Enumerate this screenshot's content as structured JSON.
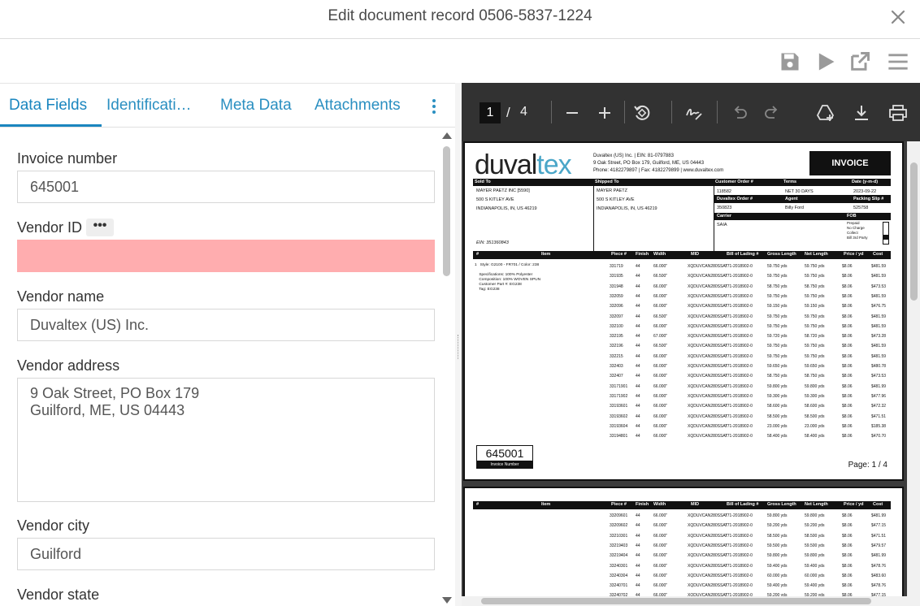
{
  "window": {
    "title": "Edit document record 0506-5837-1224"
  },
  "tabs": [
    {
      "label": "Data Fields"
    },
    {
      "label": "Identificati…"
    },
    {
      "label": "Meta Data"
    },
    {
      "label": "Attachments"
    }
  ],
  "fields": {
    "invoice_number": {
      "label": "Invoice number",
      "value": "645001"
    },
    "vendor_id": {
      "label": "Vendor ID",
      "value": "",
      "more": "•••"
    },
    "vendor_name": {
      "label": "Vendor name",
      "value": "Duvaltex (US) Inc."
    },
    "vendor_address": {
      "label": "Vendor address",
      "value": "9 Oak Street, PO Box 179\nGuilford, ME, US 04443"
    },
    "vendor_city": {
      "label": "Vendor city",
      "value": "Guilford"
    },
    "vendor_state": {
      "label": "Vendor state"
    }
  },
  "viewer": {
    "page": "1",
    "separator": "/",
    "total_pages": "4"
  },
  "invoice": {
    "logo_a": "duval",
    "logo_b": "tex",
    "vendor_line1": "Duvaltex (US) Inc. | EIN: 81-0797883",
    "vendor_line2": "9 Oak Street, PO Box 179, Guilford, ME, US 04443",
    "vendor_line3": "Phone: 4182279897 | Fax: 4182279899 | www.duvaltex.com",
    "title": "INVOICE",
    "sold_to_hdr": "Sold To",
    "shipped_to_hdr": "Shipped To",
    "cust_order_hdr": "Customer Order #",
    "terms_hdr": "Terms",
    "date_hdr": "Date (y-m-d)",
    "sold_to": "MAYER PAETZ INC [5590]\n500 S KITLEY AVE\nINDIANAPOLIS, IN, US 46219",
    "shipped_to": "MAYER PAETZ\n500 S KITLEY AVE\nINDIANAPOLIS, IN, US 46219",
    "cust_order": "118582",
    "terms": "NET 30 DAYS",
    "date": "2023-09-22",
    "duv_order_hdr": "Duvaltex Order #",
    "agent_hdr": "Agent",
    "packing_hdr": "Packing Slip #",
    "duv_order": "350823",
    "agent": "Billy Ford",
    "packing": "525758",
    "carrier_hdr": "Carrier",
    "fob_hdr": "FOB",
    "carrier": "SAIA",
    "fob_opts": "Prepaid\nNo Charge\nCollect\nBill 3rd Party",
    "ein": "EIN: 351360843",
    "col_headers": [
      "#",
      "Item",
      "Piece #",
      "Finish",
      "Width",
      "MID",
      "Bill of Lading #",
      "Gross Length",
      "Net Length",
      "Price / yd",
      "Cost"
    ],
    "item_desc": "1   Style: G2100 - FR701 / Color: 238\n\n    Specifications: 100% Polyester\n    Composition: 100% WOVEN SPUN\n    Customer Part #: EG238\n    Tag: EG238",
    "rows": [
      [
        "331719",
        "44",
        "66.000\"",
        "XQDUVCAN280SSAI",
        "771-2018902-0",
        "59.750 yds",
        "59.750 yds",
        "$8.06",
        "$481.59"
      ],
      [
        "331935",
        "44",
        "66.500\"",
        "XQDUVCAN280SSAI",
        "771-2018902-0",
        "59.750 yds",
        "59.750 yds",
        "$8.06",
        "$481.59"
      ],
      [
        "331948",
        "44",
        "66.000\"",
        "XQDUVCAN280SSAI",
        "771-2018902-0",
        "58.750 yds",
        "58.750 yds",
        "$8.06",
        "$473.53"
      ],
      [
        "332059",
        "44",
        "66.000\"",
        "XQDUVCAN280SSAI",
        "771-2018902-0",
        "59.750 yds",
        "59.750 yds",
        "$8.06",
        "$481.59"
      ],
      [
        "332096",
        "44",
        "66.000\"",
        "XQDUVCAN280SSAI",
        "771-2018902-0",
        "59.150 yds",
        "59.150 yds",
        "$8.06",
        "$476.75"
      ],
      [
        "332097",
        "44",
        "66.500\"",
        "XQDUVCAN280SSAI",
        "771-2018902-0",
        "59.750 yds",
        "59.750 yds",
        "$8.06",
        "$481.59"
      ],
      [
        "332100",
        "44",
        "66.000\"",
        "XQDUVCAN280SSAI",
        "771-2018902-0",
        "59.750 yds",
        "59.750 yds",
        "$8.06",
        "$481.59"
      ],
      [
        "332195",
        "44",
        "67.000\"",
        "XQDUVCAN280SSAI",
        "771-2018902-0",
        "59.720 yds",
        "58.720 yds",
        "$8.06",
        "$473.28"
      ],
      [
        "332196",
        "44",
        "66.500\"",
        "XQDUVCAN280SSAI",
        "771-2018902-0",
        "59.750 yds",
        "59.750 yds",
        "$8.06",
        "$481.59"
      ],
      [
        "332215",
        "44",
        "66.000\"",
        "XQDUVCAN280SSAI",
        "771-2018902-0",
        "59.750 yds",
        "59.750 yds",
        "$8.06",
        "$481.59"
      ],
      [
        "332403",
        "44",
        "66.000\"",
        "XQDUVCAN280SSAI",
        "771-2018902-0",
        "59.650 yds",
        "59.650 yds",
        "$8.06",
        "$480.78"
      ],
      [
        "332407",
        "44",
        "66.000\"",
        "XQDUVCAN280SSAI",
        "771-2018902-0",
        "58.750 yds",
        "58.750 yds",
        "$8.06",
        "$473.53"
      ],
      [
        "33171901",
        "44",
        "66.000\"",
        "XQDUVCAN280SSAI",
        "771-2018902-0",
        "59.800 yds",
        "59.800 yds",
        "$8.06",
        "$481.99"
      ],
      [
        "33171902",
        "44",
        "66.000\"",
        "XQDUVCAN280SSAI",
        "771-2018902-0",
        "59.300 yds",
        "59.300 yds",
        "$8.06",
        "$477.96"
      ],
      [
        "33193601",
        "44",
        "66.000\"",
        "XQDUVCAN280SSAI",
        "771-2018902-0",
        "58.600 yds",
        "58.600 yds",
        "$8.06",
        "$472.32"
      ],
      [
        "33193602",
        "44",
        "66.000\"",
        "XQDUVCAN280SSAI",
        "771-2018902-0",
        "58.500 yds",
        "58.500 yds",
        "$8.06",
        "$471.51"
      ],
      [
        "33193604",
        "44",
        "66.000\"",
        "XQDUVCAN280SSAI",
        "771-2018902-0",
        "23.000 yds",
        "23.000 yds",
        "$8.06",
        "$185.38"
      ],
      [
        "33194801",
        "44",
        "66.000\"",
        "XQDUVCAN280SSAI",
        "771-2018902-0",
        "58.400 yds",
        "58.400 yds",
        "$8.06",
        "$470.70"
      ]
    ],
    "invoice_number": "645001",
    "invoice_number_label": "Invoice Number",
    "page_label": "Page: 1 / 4",
    "rows2": [
      [
        "33209601",
        "44",
        "66.000\"",
        "XQDUVCAN280SSAI",
        "771-2018902-0",
        "59.800 yds",
        "59.800 yds",
        "$8.06",
        "$481.99"
      ],
      [
        "33209602",
        "44",
        "66.000\"",
        "XQDUVCAN280SSAI",
        "771-2018902-0",
        "59.200 yds",
        "59.200 yds",
        "$8.06",
        "$477.15"
      ],
      [
        "33210301",
        "44",
        "66.000\"",
        "XQDUVCAN280SSAI",
        "771-2018902-0",
        "58.500 yds",
        "58.500 yds",
        "$8.06",
        "$471.51"
      ],
      [
        "33219403",
        "44",
        "66.000\"",
        "XQDUVCAN280SSAI",
        "771-2018902-0",
        "59.500 yds",
        "59.500 yds",
        "$8.06",
        "$479.57"
      ],
      [
        "33219404",
        "44",
        "66.000\"",
        "XQDUVCAN280SSAI",
        "771-2018902-0",
        "59.800 yds",
        "59.800 yds",
        "$8.06",
        "$481.99"
      ],
      [
        "33240301",
        "44",
        "66.000\"",
        "XQDUVCAN280SSAI",
        "771-2018902-0",
        "59.400 yds",
        "59.400 yds",
        "$8.06",
        "$478.76"
      ],
      [
        "33240304",
        "44",
        "66.000\"",
        "XQDUVCAN280SSAI",
        "771-2018902-0",
        "60.000 yds",
        "60.000 yds",
        "$8.06",
        "$483.60"
      ],
      [
        "33240701",
        "44",
        "66.000\"",
        "XQDUVCAN280SSAI",
        "771-2018902-0",
        "59.400 yds",
        "59.400 yds",
        "$8.06",
        "$478.76"
      ],
      [
        "33240702",
        "44",
        "66.000\"",
        "XQDUVCAN280SSAI",
        "771-2018902-0",
        "59.200 yds",
        "59.200 yds",
        "$8.06",
        "$477.15"
      ]
    ]
  },
  "colors": {
    "accent": "#1a86bf",
    "error_field": "#ffadaf",
    "viewer_bg": "#323232"
  },
  "icons": [
    "close-icon",
    "save-icon",
    "play-icon",
    "open-external-icon",
    "menu-icon",
    "kebab-icon",
    "zoom-out-icon",
    "zoom-in-icon",
    "rotate-icon",
    "signature-icon",
    "undo-icon",
    "redo-icon",
    "drive-add-icon",
    "download-icon",
    "print-icon"
  ]
}
